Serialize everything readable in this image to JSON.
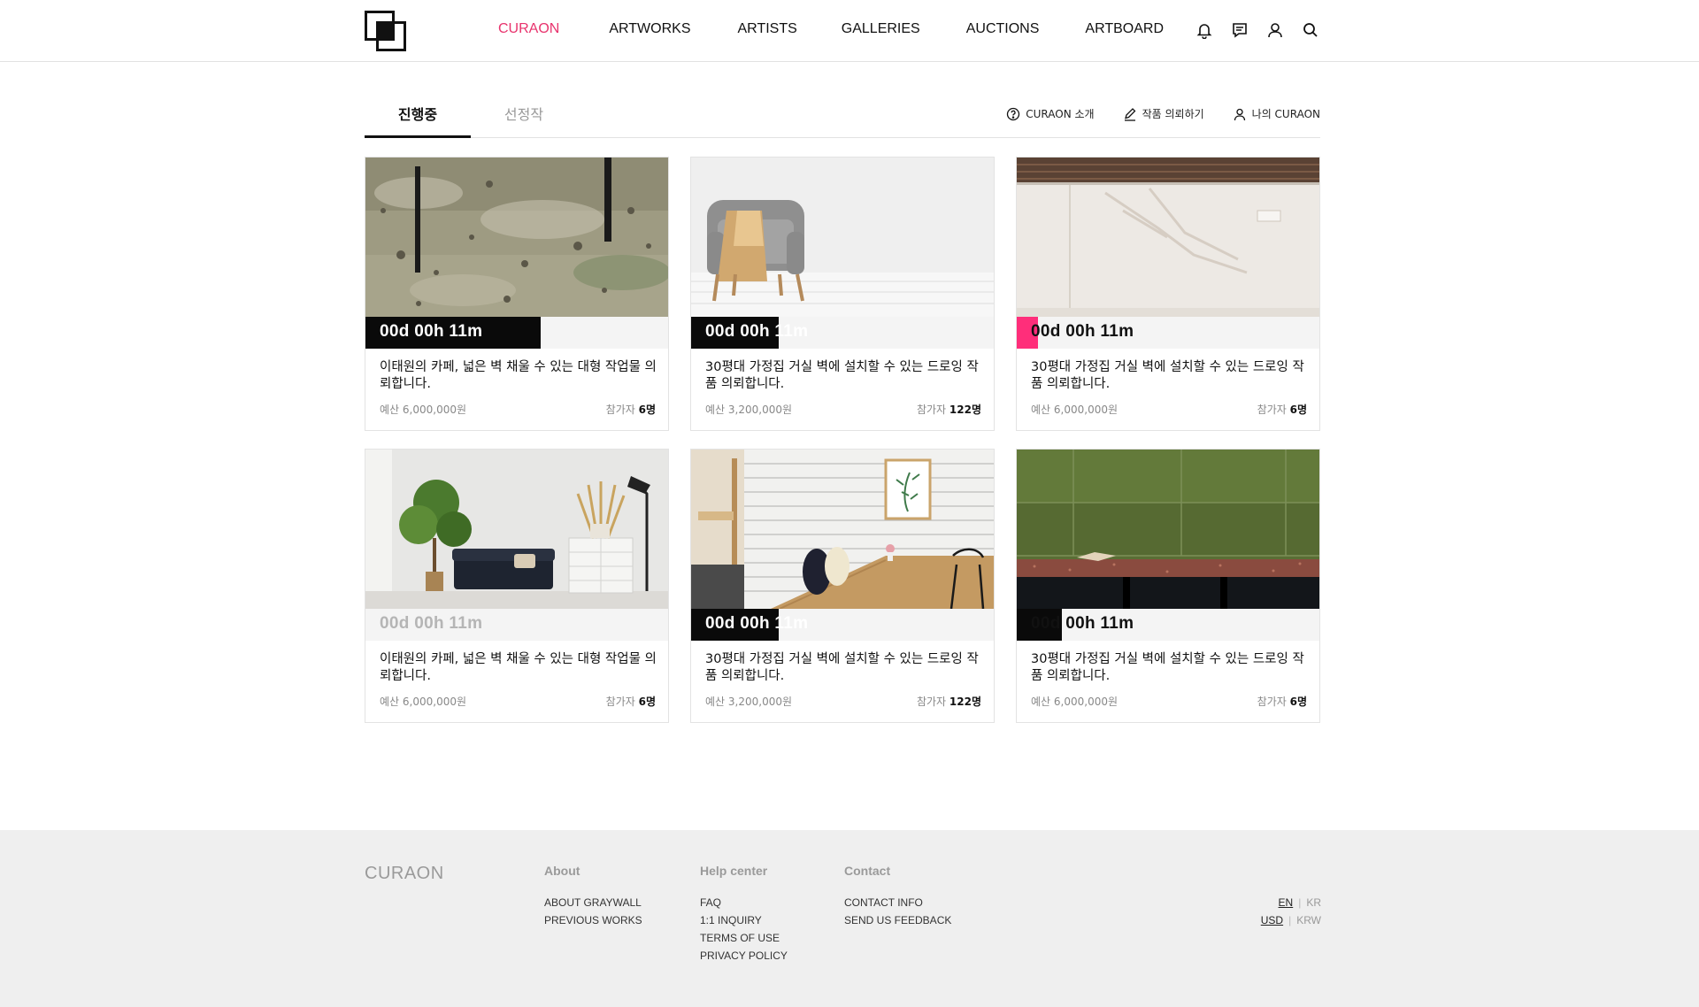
{
  "header": {
    "nav": [
      "CURAON",
      "ARTWORKS",
      "ARTISTS",
      "GALLERIES",
      "AUCTIONS",
      "ARTBOARD"
    ],
    "active_nav": "CURAON",
    "icons": [
      "bell-icon",
      "message-icon",
      "user-icon",
      "search-icon"
    ]
  },
  "tabs": {
    "active": "진행중",
    "inactive": "선정작",
    "links": [
      {
        "icon": "help-circle-icon",
        "label": "CURAON 소개"
      },
      {
        "icon": "pencil-icon",
        "label": "작품 의뢰하기"
      },
      {
        "icon": "user-icon",
        "label": "나의 CURAON"
      }
    ]
  },
  "cards": [
    {
      "timer": "00d  00h  11m",
      "progress": 0.58,
      "bar_color": "#0a0a0a",
      "title": "이태원의 카페, 넓은 벽 채울 수 있는 대형 작업물 의뢰합니다.",
      "budget": "예산 6,000,000원",
      "participants_label": "참가자",
      "participants": "6명",
      "image": "textured-wall"
    },
    {
      "timer": "00d  00h  11m",
      "progress": 0.29,
      "bar_color": "#0a0a0a",
      "title": "30평대 가정집 거실 벽에 설치할 수 있는 드로잉 작품 의뢰합니다.",
      "budget": "예산 3,200,000원",
      "participants_label": "참가자",
      "participants": "122명",
      "image": "armchair-room"
    },
    {
      "timer": "00d  00h  11m",
      "progress": 0.07,
      "bar_color": "#ff2e7a",
      "title": "30평대 가정집 거실 벽에 설치할 수 있는 드로잉 작품 의뢰합니다.",
      "budget": "예산 6,000,000원",
      "participants_label": "참가자",
      "participants": "6명",
      "image": "white-wall-shadow"
    },
    {
      "timer": "00d  00h  11m",
      "progress": 0,
      "bar_color": "#0a0a0a",
      "title": "이태원의 카페, 넓은 벽 채울 수 있는 대형 작업물 의뢰합니다.",
      "budget": "예산 6,000,000원",
      "participants_label": "참가자",
      "participants": "6명",
      "image": "living-room-sofa"
    },
    {
      "timer": "00d  00h  11m",
      "progress": 0.29,
      "bar_color": "#0a0a0a",
      "title": "30평대 가정집 거실 벽에 설치할 수 있는 드로잉 작품 의뢰합니다.",
      "budget": "예산 3,200,000원",
      "participants_label": "참가자",
      "participants": "122명",
      "image": "dining-tile-wall"
    },
    {
      "timer": "00d  00h  11m",
      "progress": 0.15,
      "bar_color": "#0a0a0a",
      "title": "30평대 가정집 거실 벽에 설치할 수 있는 드로잉 작품 의뢰합니다.",
      "budget": "예산 6,000,000원",
      "participants_label": "참가자",
      "participants": "6명",
      "image": "green-tile-wall"
    }
  ],
  "footer": {
    "logo": "CURAON",
    "columns": [
      {
        "heading": "About",
        "links": [
          "ABOUT GRAYWALL",
          "PREVIOUS WORKS"
        ]
      },
      {
        "heading": "Help center",
        "links": [
          "FAQ",
          "1:1 INQUIRY",
          "TERMS OF USE",
          "PRIVACY POLICY"
        ]
      },
      {
        "heading": "Contact",
        "links": [
          "CONTACT INFO",
          "SEND US FEEDBACK"
        ]
      }
    ],
    "language": {
      "selected": "EN",
      "other": "KR"
    },
    "currency": {
      "selected": "USD",
      "other": "KRW"
    }
  }
}
